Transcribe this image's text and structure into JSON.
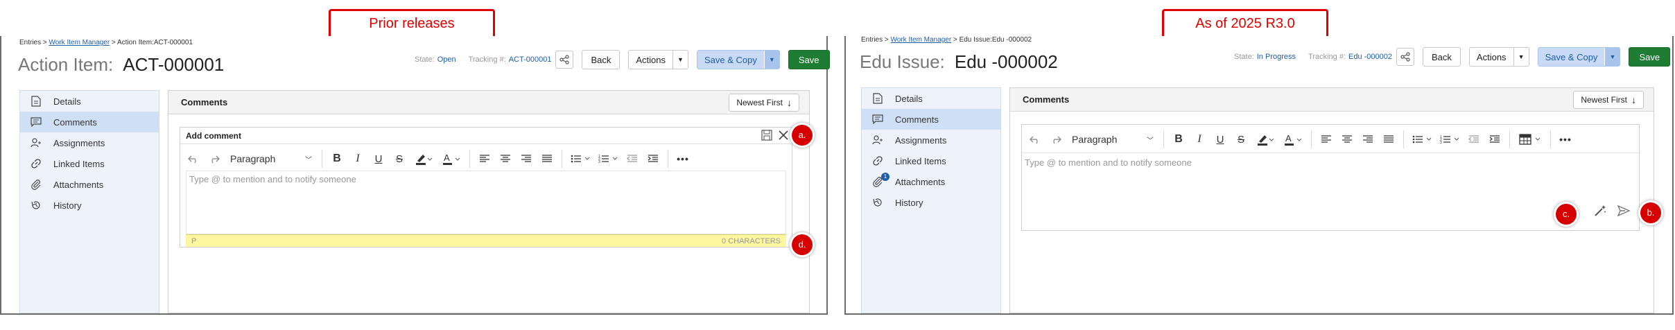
{
  "callouts": {
    "left": "Prior releases",
    "right": "As of 2025 R3.0"
  },
  "left": {
    "breadcrumb": {
      "root": "Entries",
      "sep1": " > ",
      "link": "Work Item Manager",
      "sep2": " > ",
      "current": "Action Item:ACT-000001"
    },
    "title": {
      "label": "Action Item:",
      "id": "ACT-000001"
    },
    "state_label": "State:",
    "state_value": "Open",
    "tracking_label": "Tracking #:",
    "tracking_value": "ACT-000001",
    "buttons": {
      "back": "Back",
      "actions": "Actions",
      "save_copy": "Save & Copy",
      "save": "Save"
    },
    "sidebar": [
      {
        "label": "Details",
        "icon": "document-icon"
      },
      {
        "label": "Comments",
        "icon": "comment-icon",
        "active": true
      },
      {
        "label": "Assignments",
        "icon": "user-icon"
      },
      {
        "label": "Linked Items",
        "icon": "link-icon"
      },
      {
        "label": "Attachments",
        "icon": "paperclip-icon"
      },
      {
        "label": "History",
        "icon": "history-icon"
      }
    ],
    "comments_title": "Comments",
    "sort_label": "Newest First",
    "add_comment_label": "Add comment",
    "paragraph_label": "Paragraph",
    "placeholder": "Type @ to mention and to notify someone",
    "status_left": "P",
    "status_right": "0 CHARACTERS",
    "markers": {
      "a": "a.",
      "d": "d."
    }
  },
  "right": {
    "breadcrumb": {
      "root": "Entries",
      "sep1": " > ",
      "link": "Work Item Manager",
      "sep2": " > ",
      "current": "Edu Issue:Edu -000002"
    },
    "title": {
      "label": "Edu Issue:",
      "id": "Edu -000002"
    },
    "state_label": "State:",
    "state_value": "In Progress",
    "tracking_label": "Tracking #:",
    "tracking_value": "Edu -000002",
    "buttons": {
      "back": "Back",
      "actions": "Actions",
      "save_copy": "Save & Copy",
      "save": "Save"
    },
    "sidebar": [
      {
        "label": "Details",
        "icon": "document-icon"
      },
      {
        "label": "Comments",
        "icon": "comment-icon",
        "active": true
      },
      {
        "label": "Assignments",
        "icon": "user-icon"
      },
      {
        "label": "Linked Items",
        "icon": "link-icon"
      },
      {
        "label": "Attachments",
        "icon": "paperclip-icon",
        "badge": "1"
      },
      {
        "label": "History",
        "icon": "history-icon"
      }
    ],
    "comments_title": "Comments",
    "sort_label": "Newest First",
    "paragraph_label": "Paragraph",
    "placeholder": "Type @ to mention and to notify someone",
    "markers": {
      "b": "b.",
      "c": "c."
    }
  },
  "colors": {
    "accent": "#1f5da8",
    "save_green": "#1e7c33",
    "callout_red": "#e00000",
    "status_yellow": "#fff7a0",
    "sidebar_active": "#cfe0f6"
  }
}
